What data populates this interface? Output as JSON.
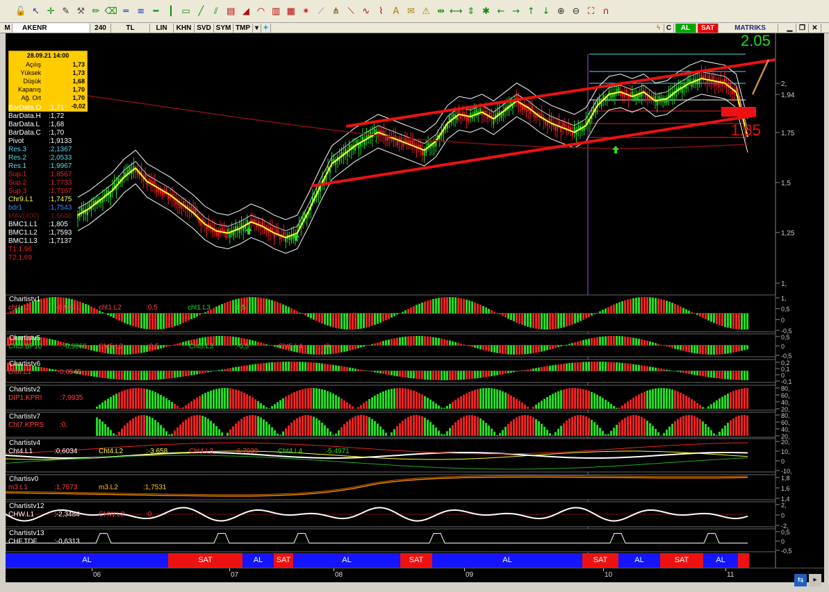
{
  "toolbar": {
    "icons": [
      "unlock-icon",
      "cursor-icon",
      "crosshair-icon",
      "edit-icon",
      "tools-icon",
      "pencil-icon",
      "eraser-icon",
      "horizontal-line-icon",
      "parallel-line-icon",
      "dash-icon",
      "vertical-line-icon",
      "box-icon",
      "trend-line-icon",
      "channel-icon",
      "fibonacci-icon",
      "fib-fan-icon",
      "fib-arc-icon",
      "fib-time-icon",
      "fib-ext-icon",
      "gann-icon",
      "speed-icon",
      "pitchfork-icon",
      "regression-icon",
      "cycle-icon",
      "pattern-icon",
      "text-icon",
      "note-icon",
      "alarm-icon",
      "arrows-h-icon",
      "arrows-lr-icon",
      "arrows-v-icon",
      "star-icon",
      "arrow-left-icon",
      "arrow-right-icon",
      "arrow-up-icon",
      "arrow-down-icon",
      "zoom-in-icon",
      "zoom-out-icon",
      "maximize-icon",
      "magnet-icon"
    ]
  },
  "symbar": {
    "m_label": "M",
    "symbol": "AKENR",
    "period": "240",
    "currency": "TL",
    "scale": "LIN",
    "khn": "KHN",
    "svd": "SVD",
    "sym": "SYM",
    "tmp": "TMP",
    "c_label": "C",
    "buy": "AL",
    "sell": "SAT",
    "brand": "MATRIKS"
  },
  "ohlc": {
    "date": "28.09.21 14:00",
    "rows": [
      {
        "k": "Açılış",
        "v": "1,73"
      },
      {
        "k": "Yüksek",
        "v": "1,73"
      },
      {
        "k": "Düşük",
        "v": "1,68"
      },
      {
        "k": "Kapanış",
        "v": "1,70"
      },
      {
        "k": "Ağ. Ort",
        "v": "1,70"
      }
    ],
    "change": "-0,02"
  },
  "levels": [
    {
      "n": "BarData.O",
      "v": ":1,71",
      "c": "#ffffff"
    },
    {
      "n": "BarData.H",
      "v": ":1,72",
      "c": "#ffffff"
    },
    {
      "n": "BarData.L",
      "v": ":1,68",
      "c": "#ffffff"
    },
    {
      "n": "BarData.C",
      "v": ":1,70",
      "c": "#ffffff"
    },
    {
      "n": "Pivot",
      "v": ":1,9133",
      "c": "#ffffff"
    },
    {
      "n": "Res.3",
      "v": ":2,1367",
      "c": "#55ddee"
    },
    {
      "n": "Res.2",
      "v": ":2,0533",
      "c": "#55ddee"
    },
    {
      "n": "Res.1",
      "v": ":1,9967",
      "c": "#55ddee"
    },
    {
      "n": "Sup.1",
      "v": ":1,8567",
      "c": "#ee2222"
    },
    {
      "n": "Sup.2",
      "v": ":1,7733",
      "c": "#ee2222"
    },
    {
      "n": "Sup.3",
      "v": ":1,7167",
      "c": "#ee2222"
    },
    {
      "n": "Chr9.L1",
      "v": ":1,7475",
      "c": "#ffff55"
    },
    {
      "n": "bdr1",
      "v": ":1,7543",
      "c": "#4488ff"
    },
    {
      "n": "MAV(400)",
      "v": ":1,6646",
      "c": "#881111"
    },
    {
      "n": "BMC1.L1",
      "v": ":1,805",
      "c": "#ffffff"
    },
    {
      "n": "BMC1.L2",
      "v": ":1,7593",
      "c": "#ffffff"
    },
    {
      "n": "BMC1.L3",
      "v": ":1,7137",
      "c": "#ffffff"
    },
    {
      "n": "T1:1,96",
      "v": "",
      "c": "#ee2222"
    },
    {
      "n": "T2:1,69",
      "v": "",
      "c": "#ee2222"
    }
  ],
  "price_axis": {
    "ticks": [
      "2,",
      "1,94",
      "1,75",
      "1,5",
      "1,25",
      "1,"
    ]
  },
  "targets": {
    "t1": "2.05",
    "t2": "1.85"
  },
  "panels": [
    {
      "id": "p1",
      "title": "Chartistv1",
      "labels": [
        {
          "t": "cht1.L1",
          "c": "#ff4444"
        },
        {
          "t": ":-0,9891",
          "c": "#ff4444"
        },
        {
          "t": "cht1.L2",
          "c": "#ff4444"
        },
        {
          "t": ":0,5",
          "c": "#ff4444"
        },
        {
          "t": "cht1.L3",
          "c": "#22dd22"
        },
        {
          "t": ":-0,5",
          "c": "#22dd22"
        }
      ],
      "ticks": [
        "1,",
        "0,5",
        "0",
        "-0,5"
      ]
    },
    {
      "id": "p2",
      "title": "Chartistv5",
      "labels": [
        {
          "t": "Cht5.BP10",
          "c": "#22dd22"
        },
        {
          "t": ":-0,9866",
          "c": "#22dd22"
        },
        {
          "t": "Cht5.L2",
          "c": "#ff4444"
        },
        {
          "t": ":0,5",
          "c": "#ff4444"
        },
        {
          "t": "Cht5.L3",
          "c": "#22dd22"
        },
        {
          "t": ":-0,5",
          "c": "#22dd22"
        },
        {
          "t": "Cht5.L4",
          "c": "#ff4444"
        },
        {
          "t": ":0",
          "c": "#ff4444"
        }
      ],
      "ticks": [
        "0,5",
        "0",
        "-0,5"
      ]
    },
    {
      "id": "p3",
      "title": "Chartistv6",
      "labels": [
        {
          "t": "cht6.L1",
          "c": "#ff4444"
        },
        {
          "t": ":-0,0545",
          "c": "#ff4444"
        }
      ],
      "ticks": [
        "0,2",
        "0,1",
        "0",
        "-0,1"
      ]
    },
    {
      "id": "p4",
      "title": "Chartistv2",
      "labels": [
        {
          "t": "DIP1.KPRI",
          "c": "#ff4444"
        },
        {
          "t": ":7,9935",
          "c": "#ff4444"
        }
      ],
      "ticks": [
        "80,",
        "60,",
        "40,",
        "20,"
      ]
    },
    {
      "id": "p5",
      "title": "Chartistv7",
      "labels": [
        {
          "t": "Cht7.KPRS",
          "c": "#ff4444"
        },
        {
          "t": ":0,",
          "c": "#ff4444"
        }
      ],
      "ticks": [
        "80,",
        "60,",
        "40,",
        "20,"
      ]
    },
    {
      "id": "p6",
      "title": "Chartistv4",
      "labels": [
        {
          "t": "Cht4.L1",
          "c": "#ffffff"
        },
        {
          "t": ":0,6034",
          "c": "#ffffff"
        },
        {
          "t": "Cht4.L2",
          "c": "#ffff55"
        },
        {
          "t": ":-3,658",
          "c": "#ffff55"
        },
        {
          "t": "Cht4.L3",
          "c": "#ff4444"
        },
        {
          "t": ":6,7039",
          "c": "#ff4444"
        },
        {
          "t": "Cht4.L4",
          "c": "#22dd22"
        },
        {
          "t": ":-5,4971",
          "c": "#22dd22"
        }
      ],
      "ticks": [
        "20,",
        "10,",
        "0",
        "-10,"
      ]
    },
    {
      "id": "p7",
      "title": "Chartisv0",
      "labels": [
        {
          "t": "m3.L1",
          "c": "#ff4444"
        },
        {
          "t": ":1,7573",
          "c": "#ff4444"
        },
        {
          "t": "m3.L2",
          "c": "#ffcc00"
        },
        {
          "t": ":1,7531",
          "c": "#ffcc00"
        }
      ],
      "ticks": [
        "1,8",
        "1,6",
        "1,4"
      ]
    },
    {
      "id": "p8",
      "title": "Chartistv12",
      "labels": [
        {
          "t": "CHW.L1",
          "c": "#ffffff"
        },
        {
          "t": ":-2,3484",
          "c": "#ffffff"
        },
        {
          "t": "CHW.L2",
          "c": "#ff4444"
        },
        {
          "t": ":0,",
          "c": "#ff4444"
        }
      ],
      "ticks": [
        "2,",
        "0",
        "-2,"
      ]
    },
    {
      "id": "p9",
      "title": "Chartistv13",
      "labels": [
        {
          "t": "CHF.TDF",
          "c": "#ffffff"
        },
        {
          "t": ":-0,6313",
          "c": "#ffffff"
        }
      ],
      "ticks": [
        "0,5",
        "0",
        "-0,5"
      ]
    }
  ],
  "signals": [
    {
      "t": "AL",
      "c": "#1515ff"
    },
    {
      "t": "SAT",
      "c": "#ee1111"
    },
    {
      "t": "AL",
      "c": "#1515ff"
    },
    {
      "t": "SAT",
      "c": "#ee1111"
    },
    {
      "t": "AL",
      "c": "#1515ff"
    },
    {
      "t": "SAT",
      "c": "#ee1111"
    },
    {
      "t": "AL",
      "c": "#1515ff"
    },
    {
      "t": "SAT",
      "c": "#ee1111"
    },
    {
      "t": "AL",
      "c": "#1515ff"
    },
    {
      "t": "SAT",
      "c": "#ee1111"
    },
    {
      "t": "AL",
      "c": "#1515ff"
    },
    {
      "t": "",
      "c": "#ee1111"
    }
  ],
  "dates": [
    "06",
    "07",
    "08",
    "09",
    "10",
    "11"
  ],
  "chart_data": {
    "type": "candlestick",
    "symbol": "AKENR",
    "period": "240",
    "x": [
      "06",
      "07",
      "08",
      "09",
      "10",
      "11"
    ],
    "close_path": [
      1.35,
      1.38,
      1.42,
      1.46,
      1.52,
      1.56,
      1.5,
      1.47,
      1.44,
      1.4,
      1.36,
      1.31,
      1.28,
      1.27,
      1.29,
      1.32,
      1.3,
      1.27,
      1.25,
      1.27,
      1.37,
      1.48,
      1.58,
      1.62,
      1.66,
      1.69,
      1.72,
      1.7,
      1.68,
      1.66,
      1.64,
      1.68,
      1.76,
      1.8,
      1.79,
      1.81,
      1.78,
      1.82,
      1.86,
      1.83,
      1.79,
      1.76,
      1.74,
      1.72,
      1.75,
      1.84,
      1.89,
      1.9,
      1.88,
      1.9,
      1.86,
      1.87,
      1.91,
      1.94,
      1.96,
      1.95,
      1.94,
      1.9,
      1.7
    ],
    "ylim": [
      1.0,
      2.1
    ],
    "channel": {
      "upper": [
        [
          1.76,
          2.16
        ],
        [
          1.5,
          2.08
        ]
      ],
      "lower": [
        [
          1.5,
          1.86
        ]
      ]
    },
    "targets": {
      "T1": 1.96,
      "T2": 1.69
    }
  }
}
